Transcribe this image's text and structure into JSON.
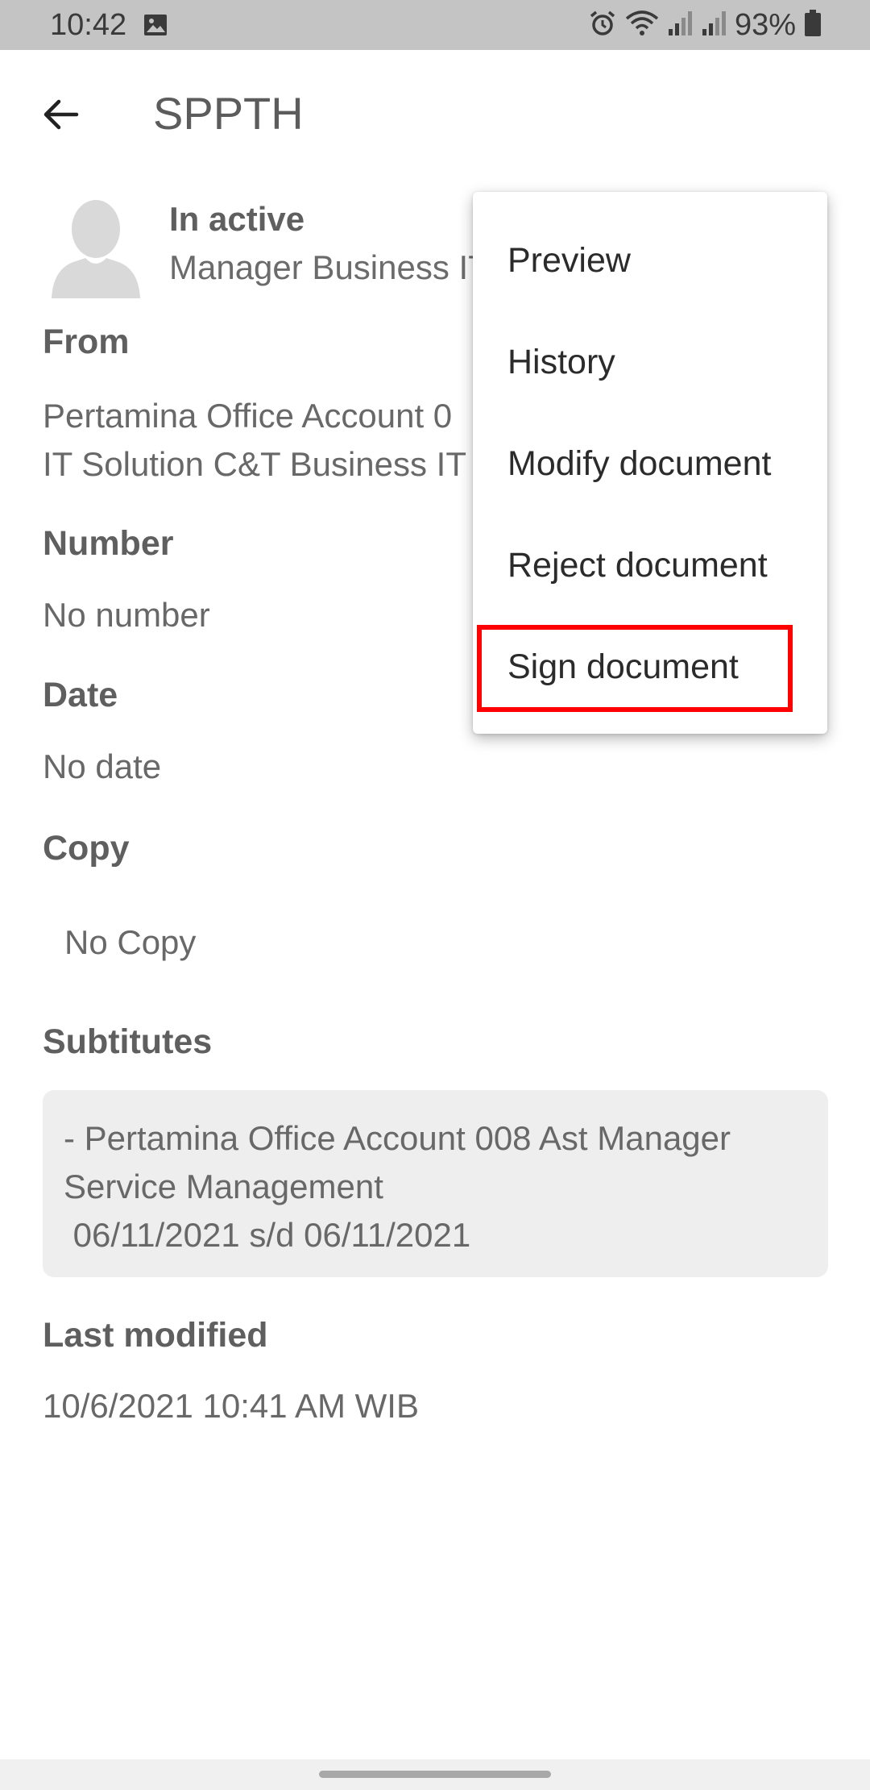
{
  "status_bar": {
    "time": "10:42",
    "battery": "93%",
    "icons": [
      "gallery-icon",
      "alarm-icon",
      "wifi-icon",
      "signal-icon",
      "signal-icon",
      "battery-icon"
    ]
  },
  "header": {
    "title": "SPPTH",
    "back_icon": "arrow-back-icon"
  },
  "sender": {
    "status": "In active",
    "role": "Manager Business IT"
  },
  "details": {
    "from_label": "From",
    "from_lines": [
      "Pertamina Office Account 0",
      "IT Solution C&T Business IT"
    ],
    "number_label": "Number",
    "number_value": "No number",
    "date_label": "Date",
    "date_value": "No date",
    "copy_label": "Copy",
    "copy_value": "No Copy",
    "substitutes_label": "Subtitutes",
    "substitutes_lines": [
      "- Pertamina Office Account 008 Ast Manager",
      "Service Management",
      " 06/11/2021 s/d 06/11/2021"
    ],
    "last_modified_label": "Last modified",
    "last_modified_value": "10/6/2021 10:41 AM WIB"
  },
  "menu": {
    "items": [
      "Preview",
      "History",
      "Modify document",
      "Reject document",
      "Sign document"
    ],
    "highlight_color": "#ff0000"
  }
}
